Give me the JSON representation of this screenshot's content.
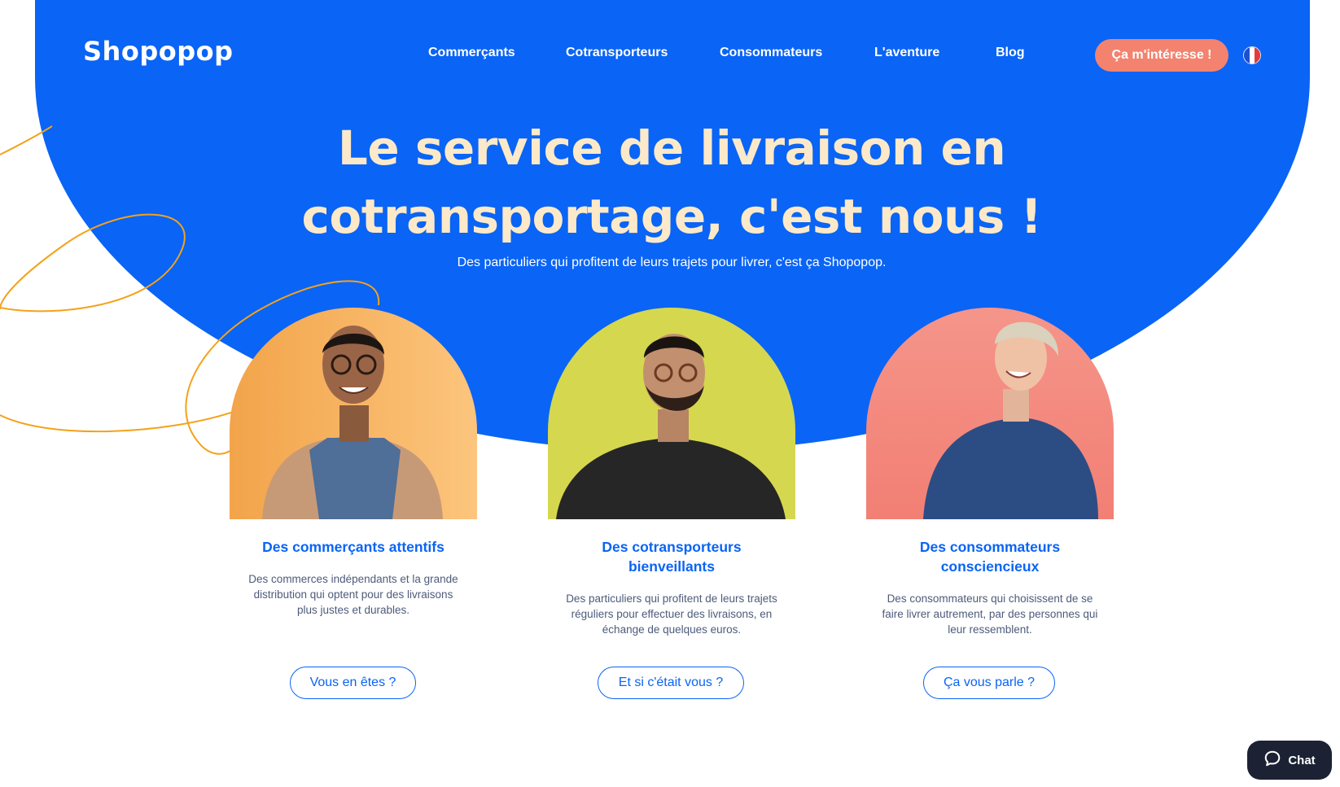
{
  "brand": {
    "logo_text": "Shopopop"
  },
  "nav": {
    "items": [
      "Commerçants",
      "Cotransporteurs",
      "Consommateurs",
      "L'aventure",
      "Blog"
    ],
    "cta_label": "Ça m'intéresse !",
    "language_flag": "flag-fr-icon"
  },
  "hero": {
    "title": "Le service de livraison en cotransportage, c'est nous !",
    "subtitle": "Des particuliers qui profitent de leurs trajets pour livrer, c'est ça Shopopop."
  },
  "cards": [
    {
      "title": "Des commerçants attentifs",
      "text": "Des commerces indépendants et la grande distribution qui optent pour des livraisons plus justes et durables.",
      "button": "Vous en êtes ?"
    },
    {
      "title": "Des cotransporteurs bienveillants",
      "text": "Des particuliers qui profitent de leurs trajets réguliers pour effectuer des livraisons, en échange de quelques euros.",
      "button": "Et si c'était vous ?"
    },
    {
      "title": "Des consommateurs consciencieux",
      "text": "Des consommateurs qui choisissent de se faire livrer autrement, par des personnes qui leur ressemblent.",
      "button": "Ça vous parle ?"
    }
  ],
  "chat": {
    "label": "Chat",
    "icon": "chat-bubble-icon"
  },
  "colors": {
    "primary_blue": "#0a64f5",
    "cta_coral": "#f3836e",
    "hero_title": "#fbe9c9",
    "deco_orange": "#f4a21a",
    "card1_bg": "#f7b062",
    "card2_bg": "#d4d64c",
    "card3_bg": "#f69688"
  }
}
